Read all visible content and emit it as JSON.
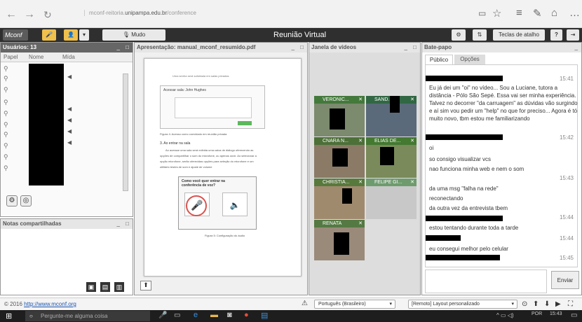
{
  "browser": {
    "url_prefix": "mconf-reitoria.",
    "url_domain": "unipampa.edu.br",
    "url_path": "/conference"
  },
  "app": {
    "logo": "Mconf",
    "mode_label": "Mudo",
    "title": "Reunião Virtual",
    "shortcut_label": "Teclas de atalho",
    "help_label": "?"
  },
  "users": {
    "title": "Usuários: 13",
    "col_role": "Papel",
    "col_name": "Nome",
    "col_media": "Mída"
  },
  "notes": {
    "title": "Notas compartilhadas"
  },
  "presentation": {
    "title": "Apresentação: manual_mconf_resumido.pdf",
    "fig4_caption": "Figura 4: Acesso como convidado em reunião privada",
    "section": "3. Ao entrar na sala",
    "fig5_caption": "Figura 5: Configuração do áudio",
    "popup_title": "Como você quer entrar na conferência de voz?",
    "intro_text": "Uma senha será solicitada em salas privadas",
    "dialog_title": "Acessar sala: John Hughes",
    "body_text_1": "Ao acessar uma sala será exibida uma caixa de diálogo oferecendo as",
    "body_text_2": "opções de compartilhar o som do microfone, ou apenas ouvir. Ao selecionar a",
    "body_text_3": "opção microfone, serão oferecidas opções para seleção do microfone e um",
    "body_text_4": "utilitário testes de som e ajuste de volume"
  },
  "video": {
    "title": "Janela de vídeos",
    "tiles": [
      "VERONIC...",
      "SAND...",
      "CNARA N...",
      "ELIAS DE...",
      "CHRISTIA...",
      "FELIPE GI...",
      "RENATA"
    ]
  },
  "chat": {
    "title": "Bate-papo",
    "tab_public": "Público",
    "tab_options": "Opções",
    "messages": [
      {
        "time": "15:41",
        "text": "Eu já dei um \"oi\" no vídeo... Sou a Luciane, tutora a distância - Pólo São Sepé.  Essa vai ser minha experiência. Talvez no decorrer \"da carruagem\" as dúvidas vão surgindo e aí sim vou pedir um \"help\" no que for preciso... Agora é tó muito novo, tbm estou me familiarizando"
      },
      {
        "time": "15:42",
        "text": "oi"
      },
      {
        "time": "",
        "text": "so consigo visualizar vcs"
      },
      {
        "time": "",
        "text": "nao funciona minha web e nem o som"
      },
      {
        "time": "15:43",
        "text": "da uma msg \"falha na rede\""
      },
      {
        "time": "",
        "text": "reconectando"
      },
      {
        "time": "",
        "text": "da outra vez da entrevista tbem"
      },
      {
        "time": "15:44",
        "text": "estou tentando durante toda a tarde"
      },
      {
        "time": "15:44",
        "text": "eu consegui melhor pelo celular"
      },
      {
        "time": "15:45",
        "text": ""
      }
    ],
    "send_label": "Enviar"
  },
  "footer": {
    "copyright": "© 2016 ",
    "link": "http://www.mconf.org",
    "language": "Português (Brasileiro)",
    "layout": "[Remoto] Layout personalizado"
  },
  "taskbar": {
    "search_placeholder": "Pergunte-me alguma coisa",
    "lang": "POR",
    "time": "15:43"
  }
}
